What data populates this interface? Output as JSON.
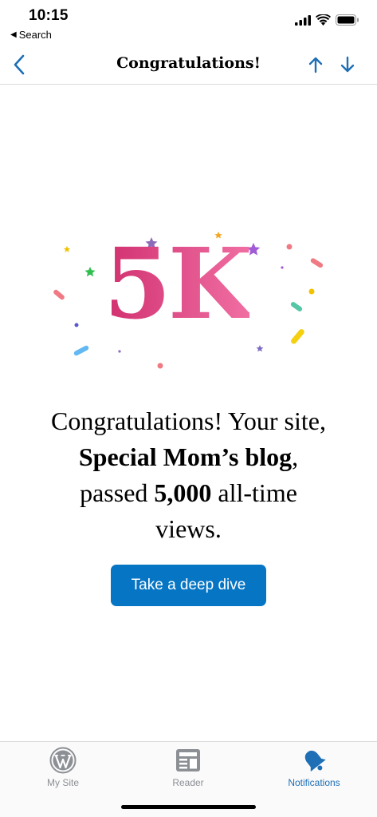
{
  "status_bar": {
    "time": "10:15",
    "back_app": "Search",
    "icons": [
      "cellular-signal-icon",
      "wifi-icon",
      "battery-icon"
    ]
  },
  "nav": {
    "title": "Congratulations!",
    "back_icon": "chevron-left-icon",
    "prev_icon": "arrow-up-icon",
    "next_icon": "arrow-down-icon",
    "accent": "#1e6fb6"
  },
  "hero": {
    "milestone": "5K",
    "colors": [
      "#d1306f",
      "#f06ea2"
    ]
  },
  "message": {
    "part1": "Congratulations! Your site,",
    "site_name": "Special Mom’s blog",
    "part2": ",",
    "part3": "passed",
    "count": "5,000",
    "part4": "all-time",
    "part5": "views."
  },
  "cta": {
    "label": "Take a deep dive",
    "color": "#0675c4"
  },
  "tab_bar": {
    "tabs": [
      {
        "label": "My Site",
        "icon": "wordpress-logo-icon",
        "active": false
      },
      {
        "label": "Reader",
        "icon": "reader-newspaper-icon",
        "active": false
      },
      {
        "label": "Notifications",
        "icon": "bell-icon",
        "active": true
      }
    ]
  }
}
